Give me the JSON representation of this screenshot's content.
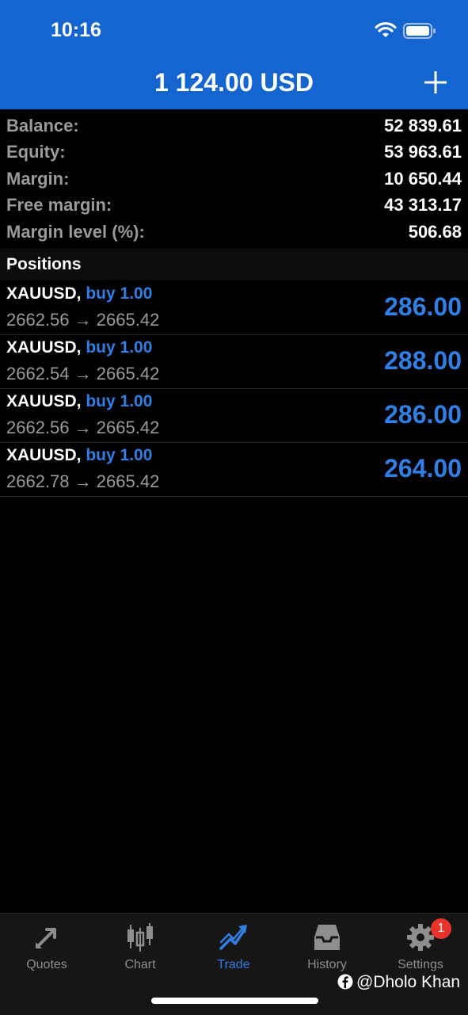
{
  "status_bar": {
    "time": "10:16"
  },
  "header": {
    "title": "1 124.00 USD"
  },
  "summary": [
    {
      "label": "Balance:",
      "value": "52 839.61"
    },
    {
      "label": "Equity:",
      "value": "53 963.61"
    },
    {
      "label": "Margin:",
      "value": "10 650.44"
    },
    {
      "label": "Free margin:",
      "value": "43 313.17"
    },
    {
      "label": "Margin level (%):",
      "value": "506.68"
    }
  ],
  "positions": {
    "section_label": "Positions",
    "items": [
      {
        "symbol": "XAUUSD,",
        "side": "buy 1.00",
        "open_price": "2662.56",
        "arrow": "→",
        "current_price": "2665.42",
        "profit": "286.00"
      },
      {
        "symbol": "XAUUSD,",
        "side": "buy 1.00",
        "open_price": "2662.54",
        "arrow": "→",
        "current_price": "2665.42",
        "profit": "288.00"
      },
      {
        "symbol": "XAUUSD,",
        "side": "buy 1.00",
        "open_price": "2662.56",
        "arrow": "→",
        "current_price": "2665.42",
        "profit": "286.00"
      },
      {
        "symbol": "XAUUSD,",
        "side": "buy 1.00",
        "open_price": "2662.78",
        "arrow": "→",
        "current_price": "2665.42",
        "profit": "264.00"
      }
    ]
  },
  "tabbar": {
    "tabs": [
      {
        "label": "Quotes",
        "icon": "quotes-arrows-icon"
      },
      {
        "label": "Chart",
        "icon": "candlestick-icon"
      },
      {
        "label": "Trade",
        "icon": "trade-trend-icon",
        "active": true
      },
      {
        "label": "History",
        "icon": "inbox-icon"
      },
      {
        "label": "Settings",
        "icon": "gear-icon",
        "badge": "1"
      }
    ]
  },
  "watermark": {
    "text": "@Dholo Khan"
  },
  "colors": {
    "header_bg": "#1565d1",
    "accent_blue": "#2f7fe6",
    "label_gray": "#9a9a9a",
    "badge_red": "#e8332d"
  }
}
